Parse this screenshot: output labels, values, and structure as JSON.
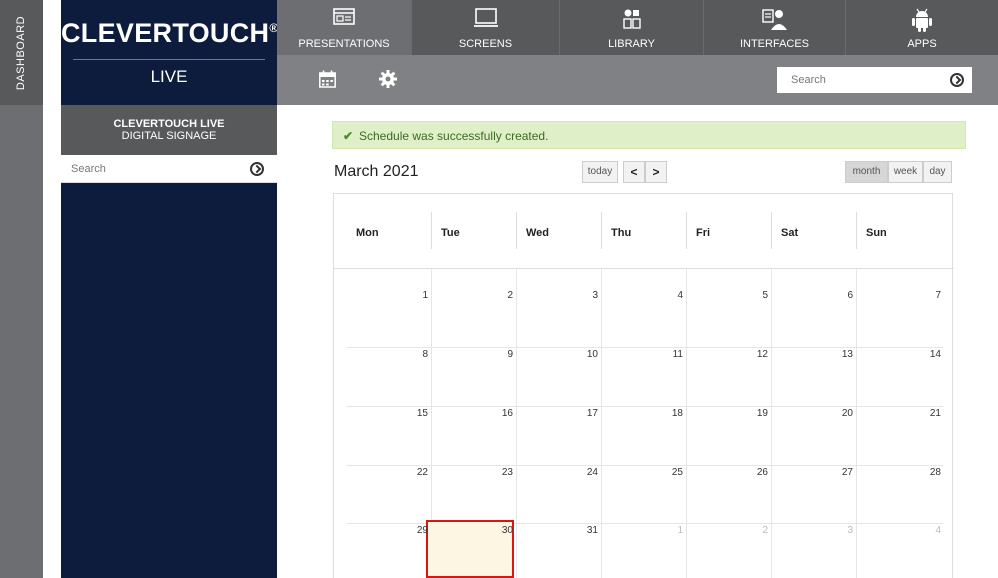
{
  "sidebar_strip": {
    "label": "DASHBOARD"
  },
  "brand": {
    "name": "CLEVERTOUCH",
    "reg": "®",
    "sub": "LIVE"
  },
  "sidebar": {
    "title": "CLEVERTOUCH LIVE",
    "subtitle": "DIGITAL SIGNAGE",
    "search_placeholder": "Search"
  },
  "topnav": {
    "tabs": [
      {
        "label": "PRESENTATIONS",
        "icon": "presentation-icon",
        "active": true
      },
      {
        "label": "SCREENS",
        "icon": "monitor-icon"
      },
      {
        "label": "LIBRARY",
        "icon": "library-icon"
      },
      {
        "label": "INTERFACES",
        "icon": "interfaces-icon"
      },
      {
        "label": "APPS",
        "icon": "android-icon"
      }
    ]
  },
  "toolbar": {
    "search_placeholder": "Search",
    "icons": [
      "calendar-icon",
      "gear-icon",
      "go-icon"
    ]
  },
  "alert": {
    "message": "Schedule was successfully created.",
    "icon": "check-icon"
  },
  "calendar": {
    "title": "March 2021",
    "today_label": "today",
    "prev_label": "<",
    "next_label": ">",
    "views": [
      "month",
      "week",
      "day"
    ],
    "active_view": "month",
    "weekdays": [
      "Mon",
      "Tue",
      "Wed",
      "Thu",
      "Fri",
      "Sat",
      "Sun"
    ],
    "weeks": [
      [
        "1",
        "2",
        "3",
        "4",
        "5",
        "6",
        "7"
      ],
      [
        "8",
        "9",
        "10",
        "11",
        "12",
        "13",
        "14"
      ],
      [
        "15",
        "16",
        "17",
        "18",
        "19",
        "20",
        "21"
      ],
      [
        "22",
        "23",
        "24",
        "25",
        "26",
        "27",
        "28"
      ],
      [
        "29",
        "30",
        "31",
        "1",
        "2",
        "3",
        "4"
      ]
    ],
    "highlighted_day": "30"
  },
  "colors": {
    "nav_dark": "#58595b",
    "brand_navy": "#0d1b3d",
    "alert_green": "#dff0c8",
    "highlight_border": "#d81616",
    "highlight_fill": "#fcf6e3"
  }
}
